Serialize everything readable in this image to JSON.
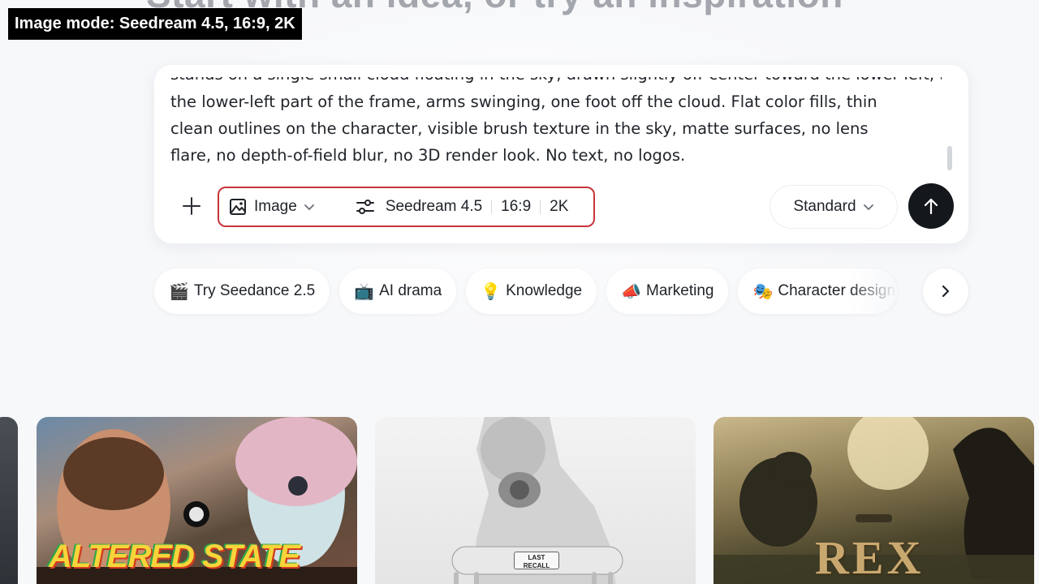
{
  "caption": "Image mode: Seedream 4.5, 16:9, 2K",
  "heading_fragment": "Start with an idea, or try an inspiration",
  "composer": {
    "prompt_lines": [
      "stands on a single small cloud floating in the sky, drawn slightly off-center toward the lower-left, happy",
      "the lower-left part of the frame, arms swinging, one foot off the cloud. Flat color fills, thin",
      "clean outlines on the character, visible brush texture in the sky, matte surfaces, no lens",
      "flare, no depth-of-field blur, no 3D render look. No text, no logos."
    ],
    "mode_label": "Image",
    "model_label": "Seedream 4.5",
    "aspect_ratio": "16:9",
    "resolution": "2K",
    "quality_label": "Standard",
    "icons": {
      "add": "plus-icon",
      "mode": "image-icon",
      "settings": "sliders-icon",
      "send": "arrow-up-icon",
      "dropdown": "chevron-down-icon"
    },
    "highlight_color": "#c7353a"
  },
  "chips": [
    {
      "emoji": "🎬",
      "label": "Try Seedance 2.5"
    },
    {
      "emoji": "📺",
      "label": "AI drama"
    },
    {
      "emoji": "💡",
      "label": "Knowledge"
    },
    {
      "emoji": "📣",
      "label": "Marketing"
    },
    {
      "emoji": "🎭",
      "label": "Character design"
    }
  ],
  "gallery": [
    {
      "title": "ALTERED STATE"
    },
    {
      "title": "LAST RECALL"
    },
    {
      "title": "REX"
    }
  ]
}
